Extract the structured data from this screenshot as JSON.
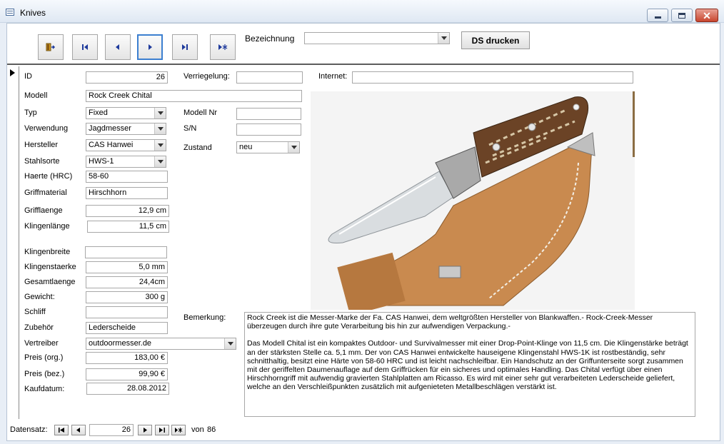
{
  "window": {
    "title": "Knives"
  },
  "header": {
    "bezeichnung_label": "Bezeichnung",
    "bezeichnung_value": "",
    "print_label": "DS drucken"
  },
  "fields": {
    "id_label": "ID",
    "id_value": "26",
    "verriegelung_label": "Verriegelung:",
    "verriegelung_value": "",
    "internet_label": "Internet:",
    "internet_value": "",
    "modell_label": "Modell",
    "modell_value": "Rock Creek Chital",
    "typ_label": "Typ",
    "typ_value": "Fixed",
    "modellnr_label": "Modell Nr",
    "modellnr_value": "",
    "verwendung_label": "Verwendung",
    "verwendung_value": "Jagdmesser",
    "sn_label": "S/N",
    "sn_value": "",
    "hersteller_label": "Hersteller",
    "hersteller_value": "CAS Hanwei",
    "zustand_label": "Zustand",
    "zustand_value": "neu",
    "stahlsorte_label": "Stahlsorte",
    "stahlsorte_value": "HWS-1",
    "haerte_label": "Haerte (HRC)",
    "haerte_value": "58-60",
    "griffmaterial_label": "Griffmaterial",
    "griffmaterial_value": "Hirschhorn",
    "grifflaenge_label": "Grifflaenge",
    "grifflaenge_value": "12,9 cm",
    "klingenlaenge_label": "Klingenlänge",
    "klingenlaenge_value": "11,5 cm",
    "klingenbreite_label": "Klingenbreite",
    "klingenbreite_value": "",
    "klingenstaerke_label": "Klingenstaerke",
    "klingenstaerke_value": "5,0 mm",
    "gesamtlaenge_label": "Gesamtlaenge",
    "gesamtlaenge_value": "24,4cm",
    "gewicht_label": "Gewicht:",
    "gewicht_value": "300 g",
    "schliff_label": "Schliff",
    "schliff_value": "",
    "zubehoer_label": "Zubehör",
    "zubehoer_value": "Lederscheide",
    "vertreiber_label": "Vertreiber",
    "vertreiber_value": "outdoormesser.de",
    "preis_org_label": "Preis (org.)",
    "preis_org_value": "183,00 €",
    "preis_bez_label": "Preis (bez.)",
    "preis_bez_value": "99,90 €",
    "kaufdatum_label": "Kaufdatum:",
    "kaufdatum_value": "28.08.2012",
    "bemerkung_label": "Bemerkung:",
    "bemerkung_p1": "Rock Creek ist die Messer-Marke der Fa. CAS Hanwei, dem weltgrößten Hersteller von Blankwaffen.- Rock-Creek-Messer überzeugen durch ihre gute Verarbeitung bis hin zur aufwendigen Verpackung.-",
    "bemerkung_p2": "Das Modell Chital ist ein kompaktes Outdoor- und Survivalmesser mit einer Drop-Point-Klinge von 11,5 cm. Die Klingenstärke beträgt an der stärksten Stelle ca. 5,1 mm. Der von CAS Hanwei entwickelte hauseigene Klingenstahl HWS-1K ist rostbeständig, sehr schnitthaltig, besitzt eine Härte von 58-60 HRC und ist leicht nachschleifbar. Ein Handschutz an der Griffunterseite sorgt zusammen mit der geriffelten Daumenauflage auf dem Griffrücken für ein sicheres und optimales Handling. Das Chital verfügt über einen Hirschhorngriff mit aufwendig gravierten Stahlplatten am Ricasso. Es wird mit einer sehr gut verarbeiteten Lederscheide geliefert, welche an den Verschleißpunkten zusätzlich mit aufgenieteten Metallbeschlägen verstärkt ist."
  },
  "record_nav": {
    "label": "Datensatz:",
    "current": "26",
    "of_label": "von",
    "total": "86"
  },
  "icons": {
    "exit": "exit-door-icon",
    "first": "first-record-icon",
    "prev": "previous-record-icon",
    "next": "next-record-icon",
    "last": "last-record-icon",
    "new": "new-record-icon",
    "dropdown": "chevron-down-icon",
    "selector": "record-selector-arrow-icon",
    "photo": "knife-photo"
  },
  "colors": {
    "nav_icon": "#1e3a9c",
    "active_border": "#3c7fd0",
    "window_bg": "#e8eef6"
  }
}
